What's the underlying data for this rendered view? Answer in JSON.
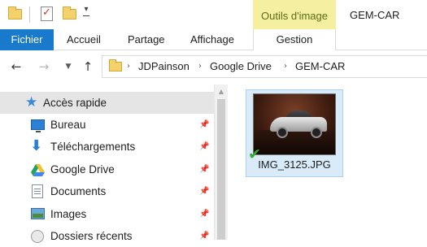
{
  "window": {
    "title": "GEM-CAR",
    "context_tab_group": "Outils d'image"
  },
  "ribbon": {
    "tabs": [
      {
        "label": "Fichier"
      },
      {
        "label": "Accueil"
      },
      {
        "label": "Partage"
      },
      {
        "label": "Affichage"
      },
      {
        "label": "Gestion"
      }
    ]
  },
  "address_bar": {
    "breadcrumbs": [
      "JDPainson",
      "Google Drive",
      "GEM-CAR"
    ],
    "separator": "›"
  },
  "navigation_pane": {
    "items": [
      {
        "label": "Accès rapide",
        "icon": "star-icon",
        "pinned": false,
        "selected": true
      },
      {
        "label": "Bureau",
        "icon": "desktop-icon",
        "pinned": true
      },
      {
        "label": "Téléchargements",
        "icon": "download-icon",
        "pinned": true
      },
      {
        "label": "Google Drive",
        "icon": "google-drive-icon",
        "pinned": true
      },
      {
        "label": "Documents",
        "icon": "documents-icon",
        "pinned": true
      },
      {
        "label": "Images",
        "icon": "images-icon",
        "pinned": true
      },
      {
        "label": "Dossiers récents",
        "icon": "recent-folders-icon",
        "pinned": true
      }
    ]
  },
  "content": {
    "files": [
      {
        "name": "IMG_3125.JPG",
        "sync_status": "synced",
        "selected": true
      }
    ]
  },
  "colors": {
    "file_tab": "#1979ca",
    "context_tab": "#f4f0a0",
    "context_text": "#5b6d16",
    "selection": "#d9ebf9",
    "sync_check": "#38a838"
  }
}
